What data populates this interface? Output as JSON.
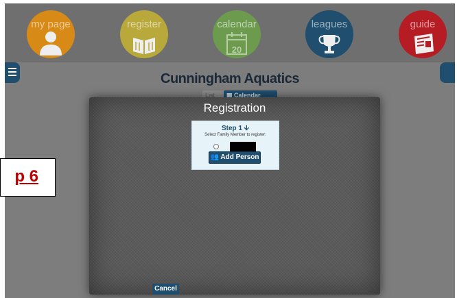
{
  "nav": {
    "items": [
      {
        "label": "my page",
        "color": "#d88a16",
        "icon": "person-icon"
      },
      {
        "label": "register",
        "color": "#b9a83a",
        "icon": "book-icon"
      },
      {
        "label": "calendar",
        "color": "#6d9b4e",
        "icon": "calendar-icon",
        "icon_text": "20"
      },
      {
        "label": "leagues",
        "color": "#1f4e6e",
        "icon": "trophy-icon"
      },
      {
        "label": "guide",
        "color": "#b61c24",
        "icon": "newspaper-icon"
      }
    ]
  },
  "page": {
    "title": "Cunningham Aquatics"
  },
  "subtabs": {
    "list": "List",
    "calendar": "Calendar"
  },
  "modal": {
    "title": "Registration",
    "step_title": "Step 1",
    "instruction": "Select Family Member to register:",
    "member_name": "",
    "add_person": "Add Person",
    "cancel": "Cancel"
  },
  "callout": {
    "text": "p 6"
  },
  "colors": {
    "accent": "#1f4e6e",
    "callout": "#c00000"
  }
}
